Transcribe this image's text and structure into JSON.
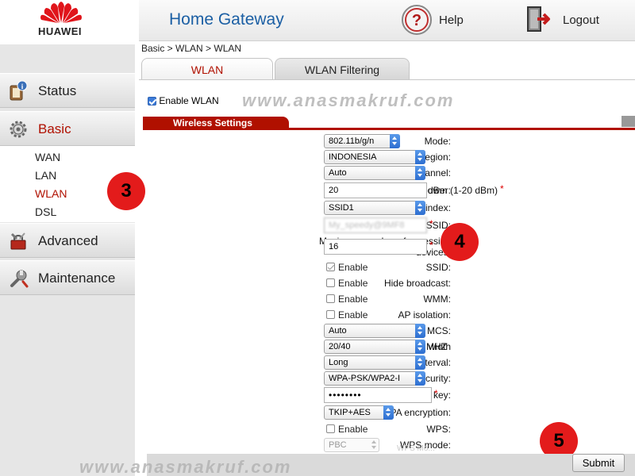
{
  "brand": {
    "logo_text": "HUAWEI",
    "accent": "#b01000"
  },
  "header": {
    "title": "Home Gateway",
    "help_label": "Help",
    "logout_label": "Logout",
    "title_color": "#1b5fa4"
  },
  "sidebar": {
    "items": [
      {
        "label": "Status",
        "icon": "status-icon"
      },
      {
        "label": "Basic",
        "icon": "basic-gear-icon",
        "active": true
      },
      {
        "label": "Advanced",
        "icon": "advanced-tools-icon"
      },
      {
        "label": "Maintenance",
        "icon": "maintenance-wrench-icon"
      }
    ],
    "basic_sub": [
      {
        "label": "WAN"
      },
      {
        "label": "LAN"
      },
      {
        "label": "WLAN",
        "active": true
      },
      {
        "label": "DSL"
      }
    ]
  },
  "breadcrumb": "Basic > WLAN > WLAN",
  "tabs": [
    {
      "label": "WLAN",
      "active": true
    },
    {
      "label": "WLAN Filtering"
    }
  ],
  "enable_wlan": {
    "label": "Enable WLAN",
    "checked": true
  },
  "watermark": "www.anasmakruf.com",
  "section_title": "Wireless Settings",
  "form": {
    "mode": {
      "label": "Mode:",
      "value": "802.11b/g/n"
    },
    "region": {
      "label": "Region:",
      "value": "INDONESIA"
    },
    "channel": {
      "label": "Channel:",
      "value": "Auto"
    },
    "transmit_power": {
      "label": "Transmit power:",
      "value": "20",
      "suffix": "dBm (1-20 dBm)",
      "required": "*"
    },
    "ssid_index": {
      "label": "SSID index:",
      "value": "SSID1"
    },
    "ssid": {
      "label": "SSID:",
      "value": "My_speedy@9MF8",
      "required": "*"
    },
    "max_devices": {
      "label_line1": "Maximum number of accessing",
      "label_line2": "devices:",
      "value": "16",
      "required": "*"
    },
    "ssid_enable": {
      "label": "SSID:",
      "option": "Enable",
      "checked": true
    },
    "hide_broadcast": {
      "label": "Hide broadcast:",
      "option": "Enable",
      "checked": false
    },
    "wmm": {
      "label": "WMM:",
      "option": "Enable",
      "checked": false
    },
    "ap_isolation": {
      "label": "AP isolation:",
      "option": "Enable",
      "checked": false
    },
    "mcs": {
      "label": "MCS:",
      "value": "Auto"
    },
    "band_width": {
      "label": "Band width",
      "value": "20/40",
      "suffix": "MHZ"
    },
    "guard_interval": {
      "label": "Guard interval:",
      "value": "Long"
    },
    "security": {
      "label": "Security:",
      "value": "WPA-PSK/WPA2-I"
    },
    "wpa_key": {
      "label": "WPA pre-shared key:",
      "value": "••••••••",
      "required": "*"
    },
    "wpa_encryption": {
      "label": "WPA encryption:",
      "value": "TKIP+AES"
    },
    "wps": {
      "label": "WPS:",
      "option": "Enable",
      "checked": false
    },
    "wps_mode": {
      "label": "WPS mode:",
      "value": "PBC"
    }
  },
  "ghost_text": "WPS Mo...",
  "badges": [
    "3",
    "4",
    "5"
  ],
  "submit_label": "Submit"
}
